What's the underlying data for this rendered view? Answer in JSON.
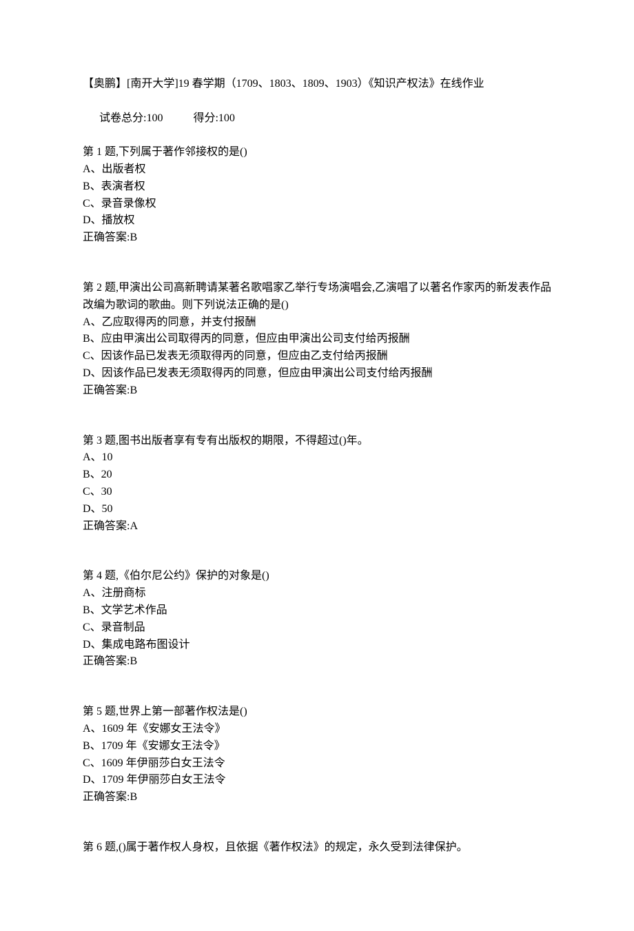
{
  "header": {
    "title": "【奥鹏】[南开大学]19 春学期（1709、1803、1809、1903）《知识产权法》在线作业",
    "score_total_label": "试卷总分:100",
    "score_got_label": "得分:100"
  },
  "questions": [
    {
      "prompt": "第 1 题,下列属于著作邻接权的是()",
      "options": [
        "A、出版者权",
        "B、表演者权",
        "C、录音录像权",
        "D、播放权"
      ],
      "answer": "正确答案:B"
    },
    {
      "prompt": "第 2 题,甲演出公司高新聘请某著名歌唱家乙举行专场演唱会,乙演唱了以著名作家丙的新发表作品改编为歌词的歌曲。则下列说法正确的是()",
      "options": [
        "A、乙应取得丙的同意，并支付报酬",
        "B、应由甲演出公司取得丙的同意，但应由甲演出公司支付给丙报酬",
        "C、因该作品已发表无须取得丙的同意，但应由乙支付给丙报酬",
        "D、因该作品已发表无须取得丙的同意，但应由甲演出公司支付给丙报酬"
      ],
      "answer": "正确答案:B"
    },
    {
      "prompt": "第 3 题,图书出版者享有专有出版权的期限，不得超过()年。",
      "options": [
        "A、10",
        "B、20",
        "C、30",
        "D、50"
      ],
      "answer": "正确答案:A"
    },
    {
      "prompt": "第 4 题,《伯尔尼公约》保护的对象是()",
      "options": [
        "A、注册商标",
        "B、文学艺术作品",
        "C、录音制品",
        "D、集成电路布图设计"
      ],
      "answer": "正确答案:B"
    },
    {
      "prompt": "第 5 题,世界上第一部著作权法是()",
      "options": [
        "A、1609 年《安娜女王法令》",
        "B、1709 年《安娜女王法令》",
        "C、1609 年伊丽莎白女王法令",
        "D、1709 年伊丽莎白女王法令"
      ],
      "answer": "正确答案:B"
    },
    {
      "prompt": "第 6 题,()属于著作权人身权，且依据《著作权法》的规定，永久受到法律保护。",
      "options": [],
      "answer": ""
    }
  ]
}
